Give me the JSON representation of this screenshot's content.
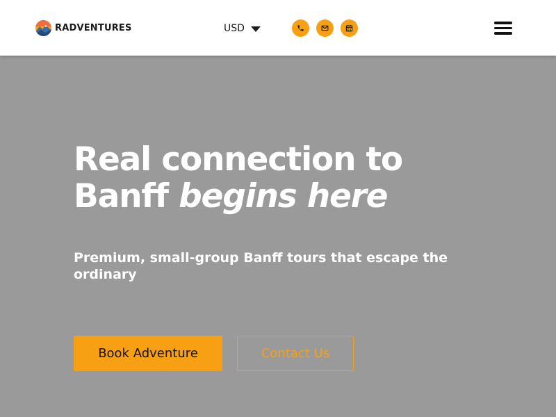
{
  "header": {
    "brand": "RADVENTURES",
    "currency": "USD",
    "contact_icons": [
      "phone-icon",
      "email-icon",
      "calendar-icon"
    ],
    "menu_icon": "hamburger-menu-icon"
  },
  "hero": {
    "headline_line1": "Real connection to",
    "headline_line2_plain": "Banff",
    "headline_line2_italic": "begins here",
    "subheadline": "Premium, small-group Banff tours that escape the ordinary",
    "primary_button": "Book Adventure",
    "secondary_button": "Contact Us"
  },
  "colors": {
    "accent": "#f7a014",
    "hero_background": "#9a9a9a",
    "header_background": "#ffffff",
    "text_dark": "#111111",
    "text_light": "#ffffff"
  }
}
